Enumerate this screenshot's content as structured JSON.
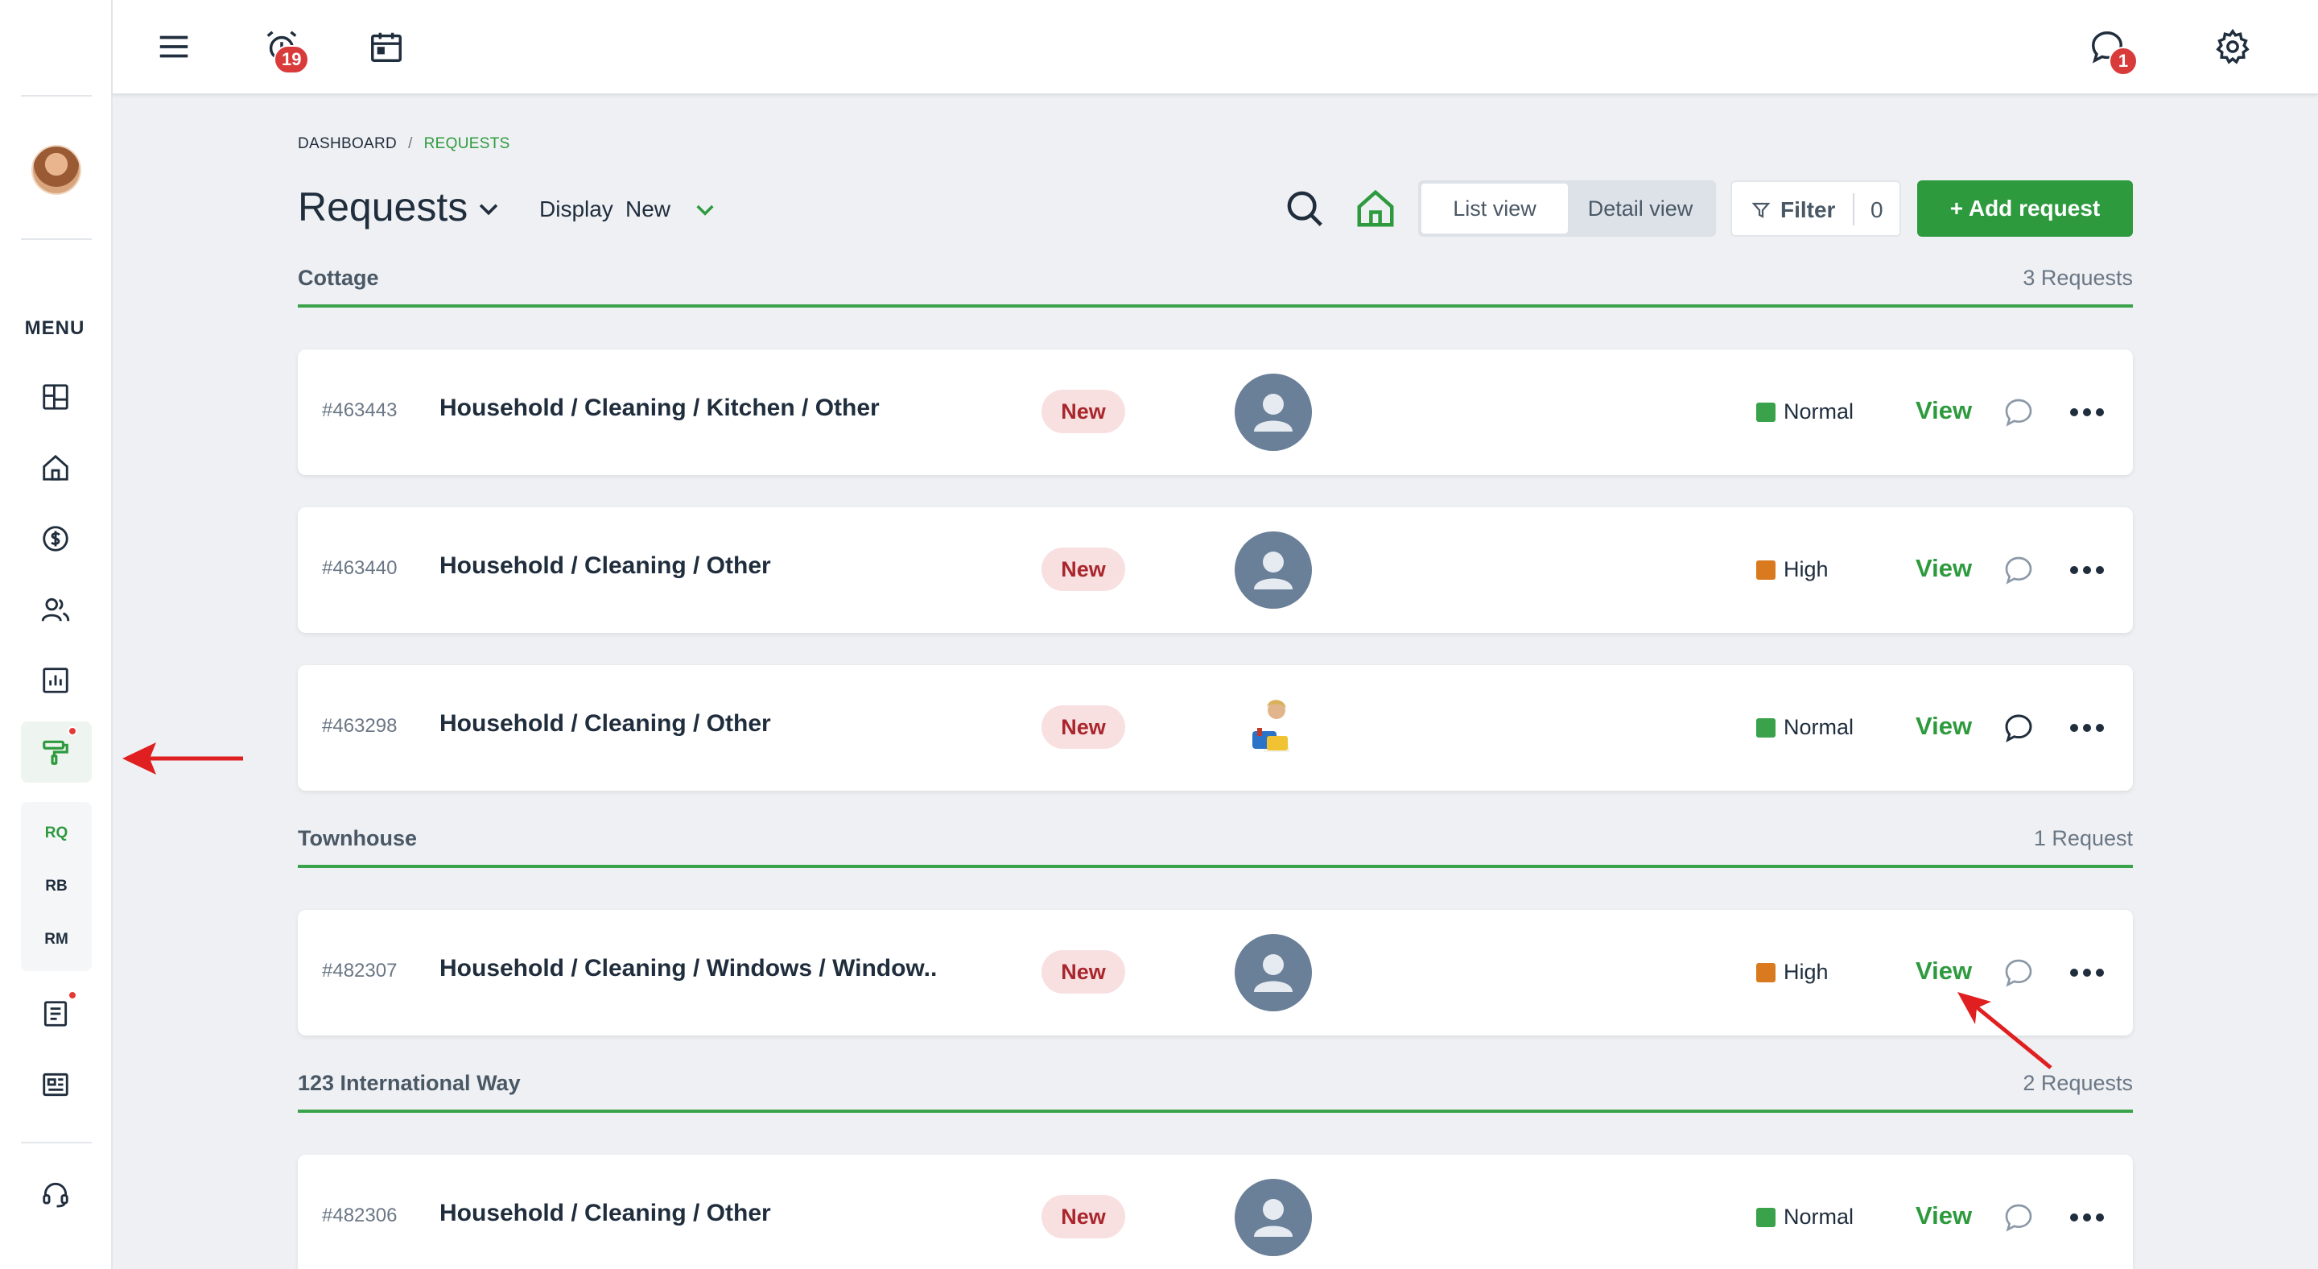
{
  "topbar": {
    "alarm_badge": "19",
    "chat_badge": "1"
  },
  "sidebar": {
    "menu_label": "MENU",
    "sub_items": [
      "RQ",
      "RB",
      "RM"
    ]
  },
  "breadcrumb": {
    "root": "DASHBOARD",
    "separator": "/",
    "current": "REQUESTS"
  },
  "header": {
    "title": "Requests",
    "display_label": "Display",
    "display_value": "New",
    "list_view": "List view",
    "detail_view": "Detail view",
    "filter_label": "Filter",
    "filter_count": "0",
    "add_label": "+ Add request"
  },
  "colors": {
    "accent": "#2e9a3e",
    "priority_normal": "#3aa24a",
    "priority_high": "#d97a1e",
    "status_bg": "#f8dfe0",
    "status_text": "#a8262c"
  },
  "groups": [
    {
      "name": "Cottage",
      "count": "3 Requests",
      "requests": [
        {
          "id": "#463443",
          "title": "Household / Cleaning / Kitchen / Other",
          "status": "New",
          "priority": "Normal",
          "view": "View",
          "avatar": "placeholder"
        },
        {
          "id": "#463440",
          "title": "Household / Cleaning / Other",
          "status": "New",
          "priority": "High",
          "view": "View",
          "avatar": "placeholder"
        },
        {
          "id": "#463298",
          "title": "Household / Cleaning / Other",
          "status": "New",
          "priority": "Normal",
          "view": "View",
          "avatar": "photo"
        }
      ]
    },
    {
      "name": "Townhouse",
      "count": "1 Request",
      "requests": [
        {
          "id": "#482307",
          "title": "Household / Cleaning / Windows / Window...",
          "status": "New",
          "priority": "High",
          "view": "View",
          "avatar": "placeholder"
        }
      ]
    },
    {
      "name": "123 International Way",
      "count": "2 Requests",
      "requests": [
        {
          "id": "#482306",
          "title": "Household / Cleaning / Other",
          "status": "New",
          "priority": "Normal",
          "view": "View",
          "avatar": "placeholder"
        }
      ]
    }
  ]
}
